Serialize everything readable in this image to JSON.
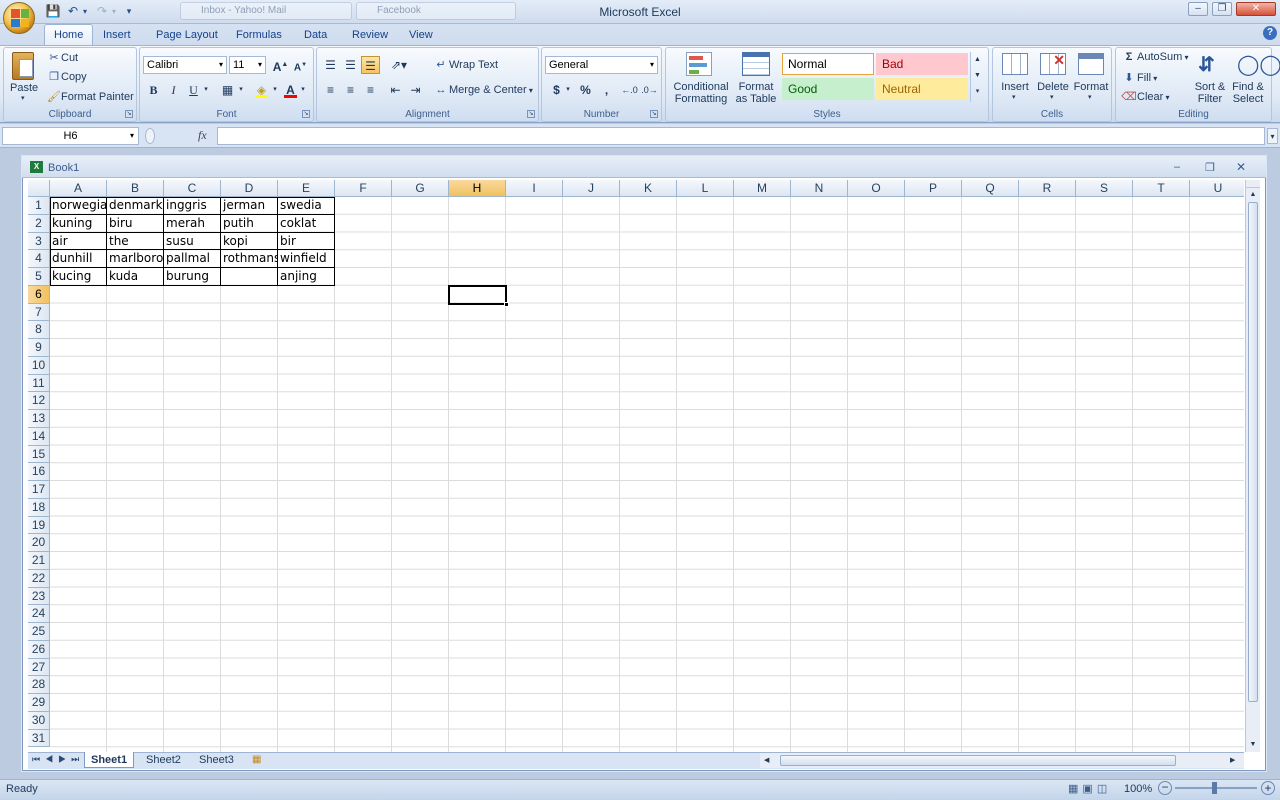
{
  "app": {
    "title": "Microsoft Excel"
  },
  "ghost_tabs": [
    "Inbox - Yahoo! Mail",
    "Facebook"
  ],
  "ribbon_tabs": [
    "Home",
    "Insert",
    "Page Layout",
    "Formulas",
    "Data",
    "Review",
    "View"
  ],
  "active_tab": "Home",
  "clipboard": {
    "paste": "Paste",
    "cut": "Cut",
    "copy": "Copy",
    "format_painter": "Format Painter",
    "label": "Clipboard"
  },
  "font": {
    "name": "Calibri",
    "size": "11",
    "label": "Font",
    "bold": "B",
    "italic": "I",
    "underline": "U",
    "grow": "A",
    "shrink": "A",
    "fontcolor": "A"
  },
  "alignment": {
    "wrap_text": "Wrap Text",
    "merge_center": "Merge & Center",
    "label": "Alignment"
  },
  "number": {
    "format": "General",
    "currency": "$",
    "percent": "%",
    "comma": ",",
    "label": "Number"
  },
  "styles": {
    "conditional_formatting": "Conditional Formatting",
    "format_as_table": "Format as Table",
    "normal": "Normal",
    "bad": "Bad",
    "good": "Good",
    "neutral": "Neutral",
    "label": "Styles"
  },
  "cells_group": {
    "insert": "Insert",
    "delete": "Delete",
    "format": "Format",
    "label": "Cells"
  },
  "editing": {
    "autosum": "AutoSum",
    "fill": "Fill",
    "clear": "Clear",
    "sort_filter": "Sort & Filter",
    "find_select": "Find & Select",
    "label": "Editing"
  },
  "formula_bar": {
    "name_box": "H6",
    "fx": "fx",
    "value": ""
  },
  "workbook": {
    "title": "Book1"
  },
  "sheet": {
    "columns": [
      "A",
      "B",
      "C",
      "D",
      "E",
      "F",
      "G",
      "H",
      "I",
      "J",
      "K",
      "L",
      "M",
      "N",
      "O",
      "P",
      "Q",
      "R",
      "S",
      "T",
      "U"
    ],
    "selected_column": "H",
    "selected_row": 6,
    "active_cell": "H6",
    "rows": [
      [
        "norwegia",
        "denmark",
        "inggris",
        "jerman",
        "swedia"
      ],
      [
        "kuning",
        "biru",
        "merah",
        "putih",
        "coklat"
      ],
      [
        "air",
        "the",
        "susu",
        "kopi",
        "bir"
      ],
      [
        "dunhill",
        "marlboro",
        "pallmal",
        "rothmans",
        "winfield"
      ],
      [
        "kucing",
        "kuda",
        "burung",
        "",
        "anjing"
      ]
    ],
    "row_count": 31
  },
  "sheet_tabs": [
    "Sheet1",
    "Sheet2",
    "Sheet3"
  ],
  "active_sheet": "Sheet1",
  "status": {
    "text": "Ready",
    "zoom": "100%"
  },
  "colors": {
    "selected_header": "#f1c15f",
    "bad_bg": "#ffc7ce",
    "bad_fg": "#9c0006",
    "good_bg": "#c6efce",
    "good_fg": "#006100",
    "neutral_bg": "#ffeb9c",
    "neutral_fg": "#9c6500"
  }
}
